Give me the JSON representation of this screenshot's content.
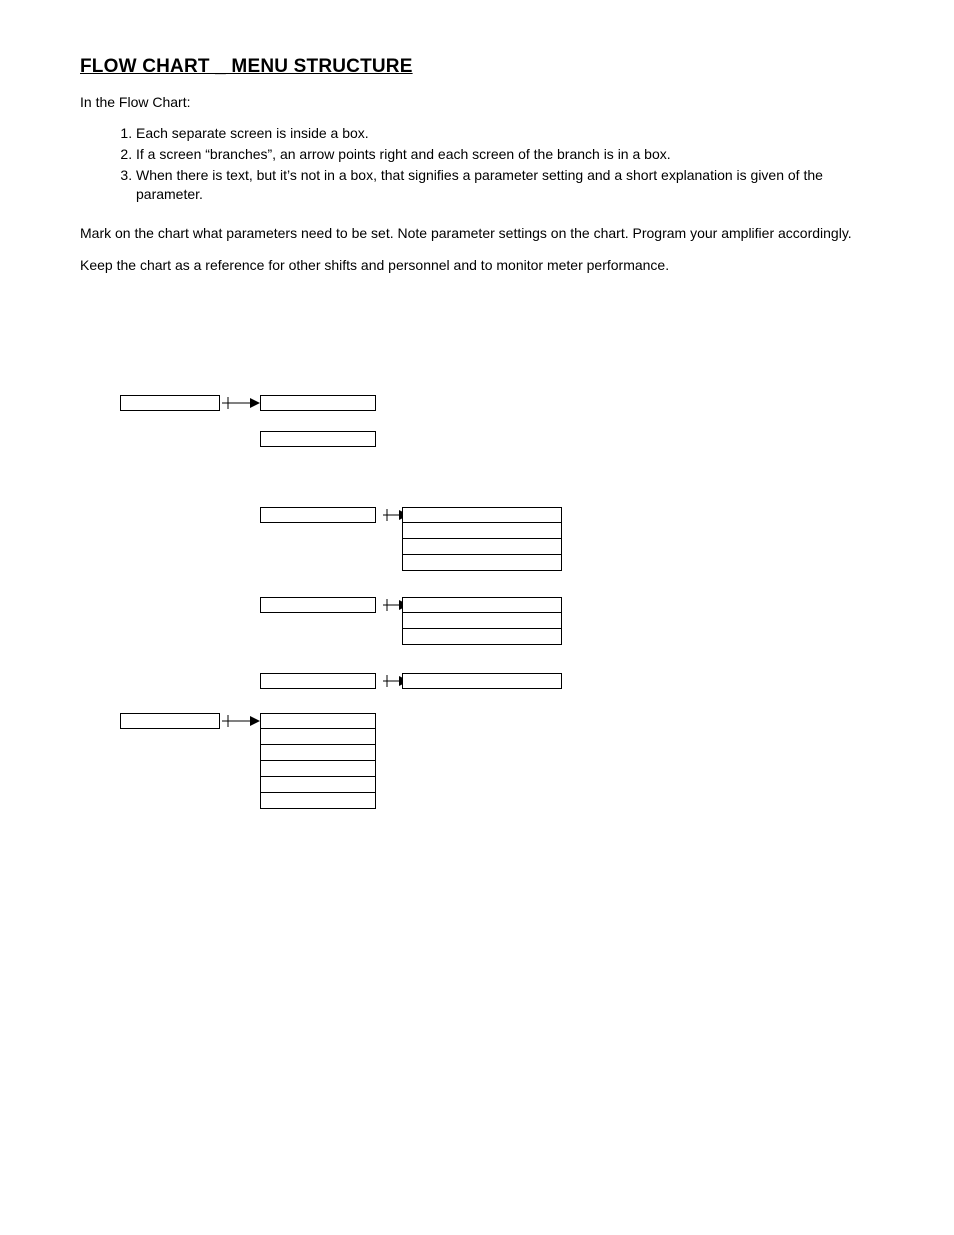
{
  "title": "FLOW CHART _ MENU STRUCTURE",
  "intro": "In the Flow Chart:",
  "rules": [
    "Each separate screen is inside a box.",
    "If a screen “branches”, an arrow points right and each screen of the branch is in a box.",
    "When there is text, but it’s not in a box, that signifies a parameter setting and a short explanation is given of the parameter."
  ],
  "para1": "Mark on the chart what parameters need to be set. Note parameter settings on the chart. Program your amplifier accordingly.",
  "para2": "Keep the chart as a reference for other shifts and personnel and to monitor meter performance."
}
